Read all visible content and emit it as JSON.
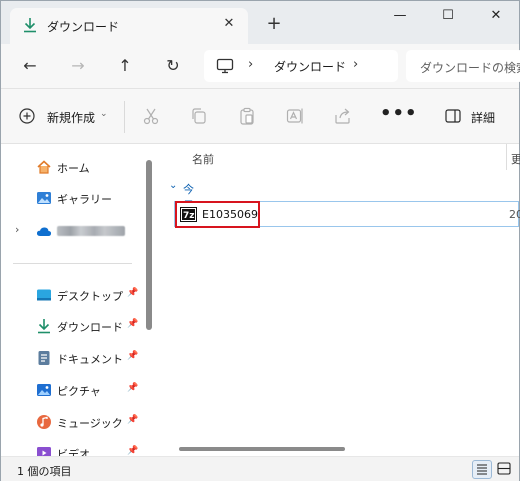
{
  "tab": {
    "title": "ダウンロード",
    "close": "✕"
  },
  "new_tab": "+",
  "window_controls": {
    "minimize": "—",
    "maximize": "☐",
    "close": "✕"
  },
  "nav": {
    "back": "←",
    "forward": "→",
    "up": "↑",
    "refresh": "↻",
    "address": {
      "chevron": "›",
      "location": "ダウンロード",
      "chevron_after": "›"
    },
    "search_placeholder": "ダウンロードの検索"
  },
  "toolbar": {
    "new_label": "新規作成",
    "new_caret": "⌄",
    "more": "•••",
    "details_label": "詳細"
  },
  "sidebar": {
    "home": "ホーム",
    "gallery": "ギャラリー",
    "onedrive_expand": "›",
    "desktop": "デスクトップ",
    "downloads": "ダウンロード",
    "documents": "ドキュメント",
    "pictures": "ピクチャ",
    "music": "ミュージック",
    "videos": "ビデオ",
    "pin": "📌"
  },
  "columns": {
    "name": "名前",
    "date": "更"
  },
  "group": {
    "label": "今日",
    "chevron": "⌄"
  },
  "files": [
    {
      "name": "E1035069",
      "date": "20"
    }
  ],
  "status": {
    "count": "1 個の項目"
  },
  "colors": {
    "accent": "#0a5fb0",
    "highlight_border": "#d7141e",
    "selection_border": "#99c6ec"
  }
}
